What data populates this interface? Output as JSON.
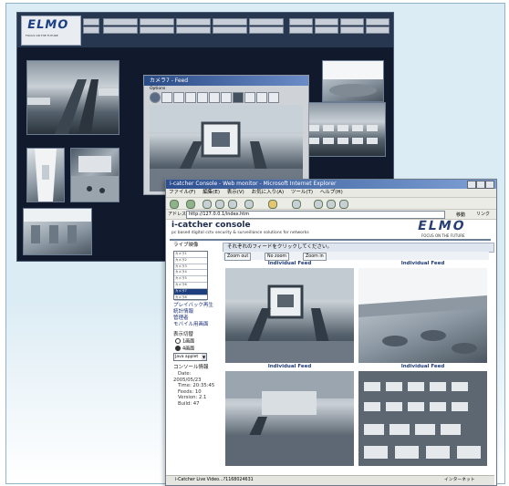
{
  "back_window": {
    "logo": "ELMO",
    "logo_tagline": "FOCUS ON THE FUTURE",
    "feed_window_title": "カメラ7 - Feed",
    "feed_options_label": "Options"
  },
  "browser": {
    "title": "i-catcher Console - Web monitor - Microsoft Internet Explorer",
    "menu": [
      "ファイル(F)",
      "編集(E)",
      "表示(V)",
      "お気に入り(A)",
      "ツール(T)",
      "ヘルプ(H)"
    ],
    "address_label": "アドレス(D)",
    "address_value": "http://127.0.0.1/index.htm",
    "go_label": "移動",
    "links_label": "リンク",
    "status_text": "i-Catcher Live Video...?1168024631",
    "status_zone": "インターネット"
  },
  "page": {
    "title": "i-catcher console",
    "subtitle": "pc based digital cctv security & surveillance solutions for networks",
    "logo": "ELMO",
    "logo_tagline": "FOCUS ON THE FUTURE",
    "live_label": "ライブ映像",
    "camera_list": [
      "カメラ1",
      "カメラ2",
      "カメラ3",
      "カメラ4",
      "カメラ5",
      "カメラ6",
      "カメラ7",
      "カメラ8"
    ],
    "camera_selected_index": 6,
    "links": [
      "プレイバック再生",
      "統計情報",
      "管理者",
      "モバイル用画面"
    ],
    "display_mode_label": "表示切替",
    "display_options": [
      "1画面",
      "4画面"
    ],
    "display_selected_index": 1,
    "applet_select": "Java applet",
    "console_info_label": "コンソール情報",
    "info": {
      "date_label": "Date:",
      "date": "2005/05/23",
      "time": "Time: 20:35:45",
      "feeds": "Feeds: 10",
      "version": "Version: 2.1",
      "build": "Build: 47"
    },
    "feeds_header": "それぞれのフィードをクリックしてください。",
    "zoom_buttons": [
      "Zoom out",
      "No zoom",
      "Zoom in"
    ],
    "feed_caption": "Individual Feed"
  },
  "colors": {
    "back_bg": "#101a2c",
    "accent_blue": "#1e3f7e",
    "frame_bg": "#dcecf4"
  }
}
